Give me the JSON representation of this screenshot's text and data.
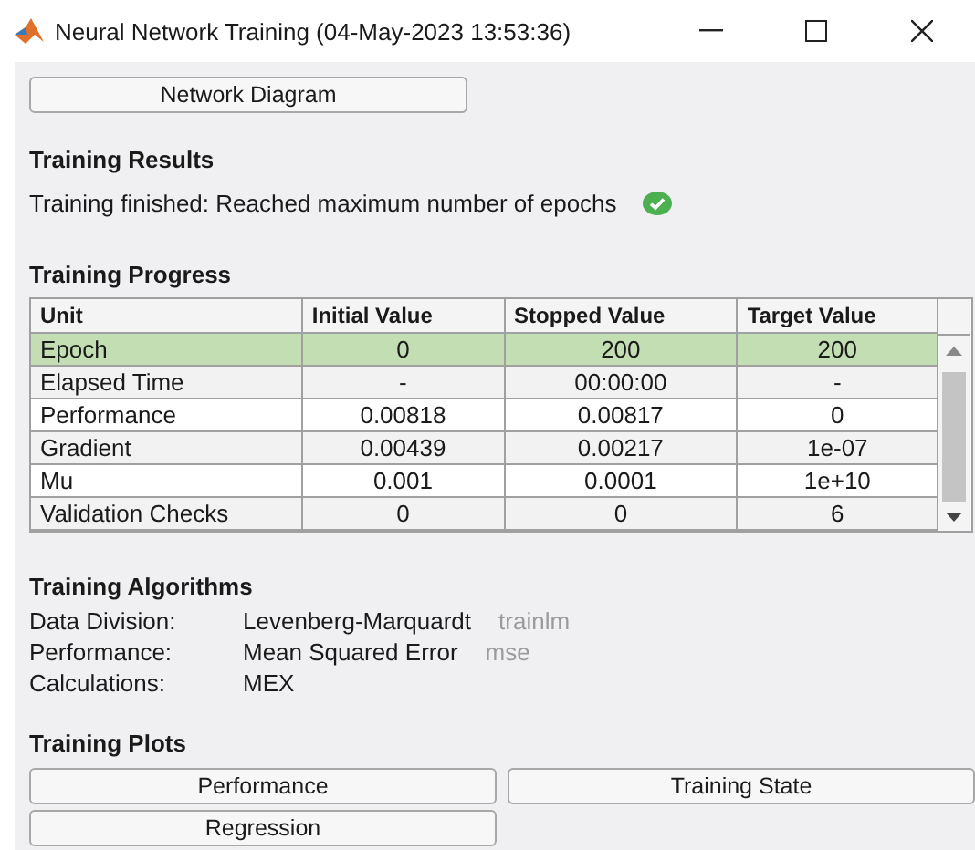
{
  "window": {
    "title": "Neural Network Training (04-May-2023 13:53:36)"
  },
  "network_button": "Network Diagram",
  "training_results": {
    "heading": "Training Results",
    "message": "Training finished: Reached maximum number of epochs",
    "complete": true
  },
  "training_progress": {
    "heading": "Training Progress",
    "columns": [
      "Unit",
      "Initial Value",
      "Stopped Value",
      "Target Value"
    ],
    "rows": [
      {
        "cells": [
          "Epoch",
          "0",
          "200",
          "200"
        ],
        "selected": true
      },
      {
        "cells": [
          "Elapsed Time",
          "-",
          "00:00:00",
          "-"
        ],
        "selected": false
      },
      {
        "cells": [
          "Performance",
          "0.00818",
          "0.00817",
          "0"
        ],
        "selected": false
      },
      {
        "cells": [
          "Gradient",
          "0.00439",
          "0.00217",
          "1e-07"
        ],
        "selected": false
      },
      {
        "cells": [
          "Mu",
          "0.001",
          "0.0001",
          "1e+10"
        ],
        "selected": false
      },
      {
        "cells": [
          "Validation Checks",
          "0",
          "0",
          "6"
        ],
        "selected": false
      }
    ]
  },
  "training_algorithms": {
    "heading": "Training Algorithms",
    "items": [
      {
        "label": "Data Division:",
        "value": "Levenberg-Marquardt",
        "code": "trainlm"
      },
      {
        "label": "Performance:",
        "value": "Mean Squared Error",
        "code": "mse"
      },
      {
        "label": "Calculations:",
        "value": "MEX"
      }
    ]
  },
  "training_plots": {
    "heading": "Training Plots",
    "buttons": [
      "Performance",
      "Training State",
      "Regression"
    ]
  }
}
